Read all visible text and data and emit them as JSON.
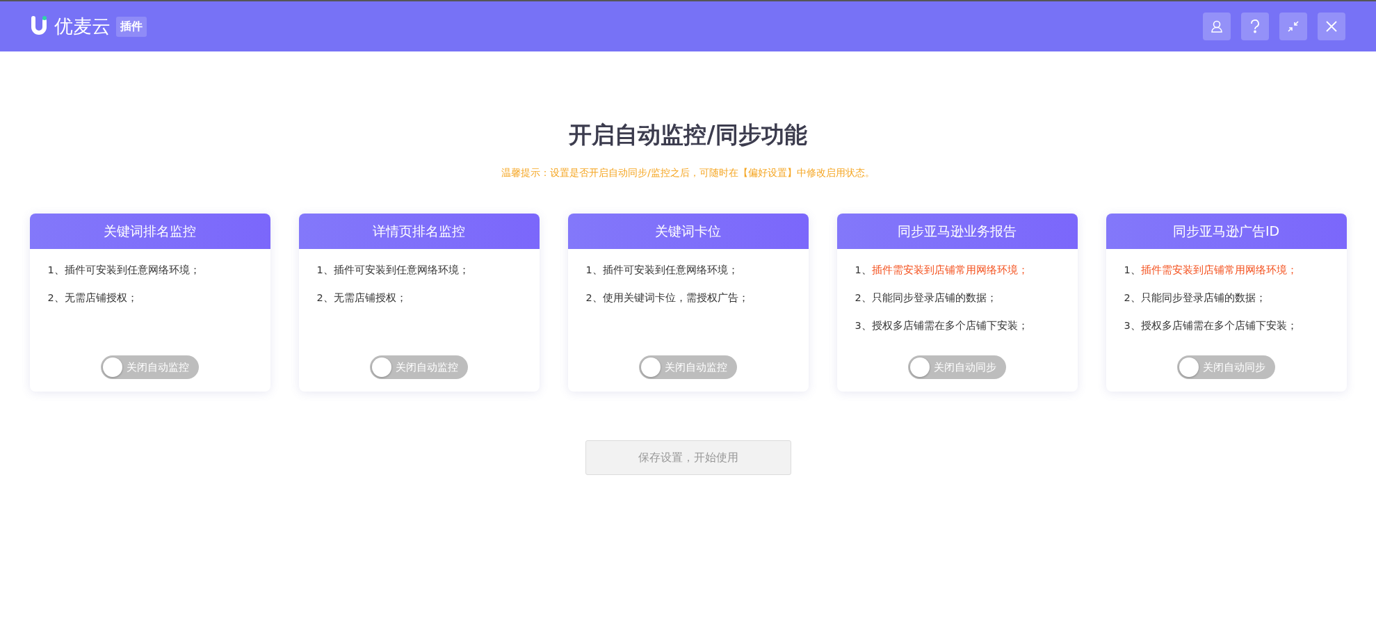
{
  "header": {
    "brand": "优麦云",
    "badge": "插件",
    "buttons": [
      {
        "kind": "user"
      },
      {
        "kind": "help"
      },
      {
        "kind": "minimize"
      },
      {
        "kind": "close"
      }
    ]
  },
  "title": "开启自动监控/同步功能",
  "hint": "温馨提示：设置是否开启自动同步/监控之后，可随时在【偏好设置】中修改启用状态。",
  "cards": [
    {
      "title": "关键词排名监控",
      "items": [
        {
          "number": "1、",
          "text": "插件可安装到任意网络环境；",
          "warning": false
        },
        {
          "number": "2、",
          "text": "无需店铺授权；",
          "warning": false
        }
      ],
      "toggle": {
        "label": "关闭自动监控",
        "on": false
      }
    },
    {
      "title": "详情页排名监控",
      "items": [
        {
          "number": "1、",
          "text": "插件可安装到任意网络环境；",
          "warning": false
        },
        {
          "number": "2、",
          "text": "无需店铺授权；",
          "warning": false
        }
      ],
      "toggle": {
        "label": "关闭自动监控",
        "on": false
      }
    },
    {
      "title": "关键词卡位",
      "items": [
        {
          "number": "1、",
          "text": "插件可安装到任意网络环境；",
          "warning": false
        },
        {
          "number": "2、",
          "text": "使用关键词卡位，需授权广告；",
          "warning": false
        }
      ],
      "toggle": {
        "label": "关闭自动监控",
        "on": false
      }
    },
    {
      "title": "同步亚马逊业务报告",
      "items": [
        {
          "number": "1、",
          "text": "插件需安装到店铺常用网络环境；",
          "warning": true
        },
        {
          "number": "2、",
          "text": "只能同步登录店铺的数据；",
          "warning": false
        },
        {
          "number": "3、",
          "text": "授权多店铺需在多个店铺下安装；",
          "warning": false
        }
      ],
      "toggle": {
        "label": "关闭自动同步",
        "on": false
      }
    },
    {
      "title": "同步亚马逊广告ID",
      "items": [
        {
          "number": "1、",
          "text": "插件需安装到店铺常用网络环境；",
          "warning": true
        },
        {
          "number": "2、",
          "text": "只能同步登录店铺的数据；",
          "warning": false
        },
        {
          "number": "3、",
          "text": "授权多店铺需在多个店铺下安装；",
          "warning": false
        }
      ],
      "toggle": {
        "label": "关闭自动同步",
        "on": false
      }
    }
  ],
  "save_button": {
    "label": "保存设置，开始使用",
    "disabled": true
  }
}
